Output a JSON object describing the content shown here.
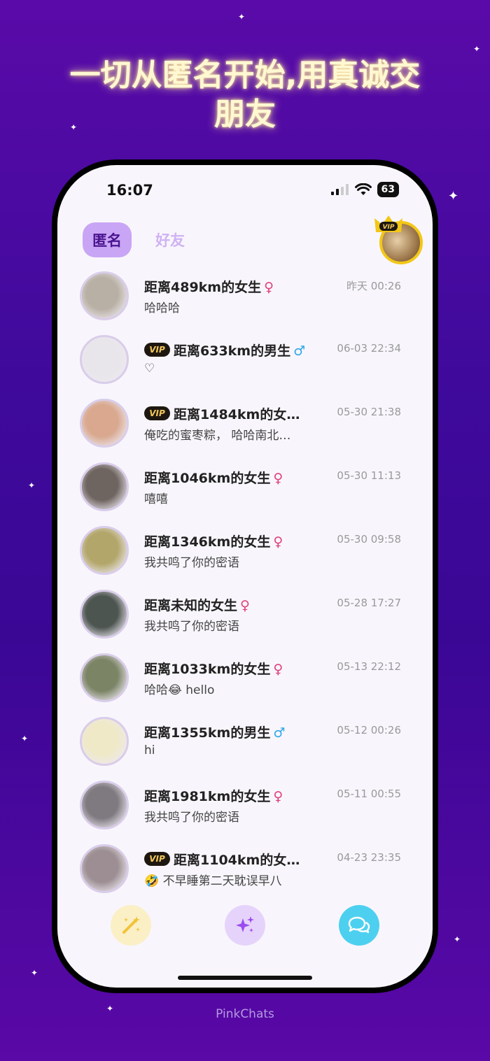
{
  "headline": {
    "line1": "一切从匿名开始,用真诚交",
    "line2": "朋友"
  },
  "status_bar": {
    "time": "16:07",
    "battery": "63"
  },
  "tabs": {
    "anonymous": "匿名",
    "friends": "好友"
  },
  "vip_label": "VIP",
  "chats": [
    {
      "name": "距离489km的女生",
      "gender": "♀",
      "vip": false,
      "message": "哈哈哈",
      "time": "昨天 00:26",
      "avatar_color": "#b8b0a4"
    },
    {
      "name": "距离633km的男生",
      "gender": "♂",
      "vip": true,
      "message": "♡",
      "time": "06-03 22:34",
      "avatar_color": "#e8e6ea"
    },
    {
      "name": "距离1484km的女…",
      "gender": "",
      "vip": true,
      "message": "俺吃的蜜枣粽， 哈哈南北…",
      "time": "05-30 21:38",
      "avatar_color": "#d9a88e"
    },
    {
      "name": "距离1046km的女生",
      "gender": "♀",
      "vip": false,
      "message": "嘻嘻",
      "time": "05-30 11:13",
      "avatar_color": "#6f6560"
    },
    {
      "name": "距离1346km的女生",
      "gender": "♀",
      "vip": false,
      "message": "我共鸣了你的密语",
      "time": "05-30 09:58",
      "avatar_color": "#b3a66a"
    },
    {
      "name": "距离未知的女生",
      "gender": "♀",
      "vip": false,
      "message": "我共鸣了你的密语",
      "time": "05-28 17:27",
      "avatar_color": "#4d5550"
    },
    {
      "name": "距离1033km的女生",
      "gender": "♀",
      "vip": false,
      "message": "哈哈😂 hello",
      "time": "05-13 22:12",
      "avatar_color": "#7c8466"
    },
    {
      "name": "距离1355km的男生",
      "gender": "♂",
      "vip": false,
      "message": "hi",
      "time": "05-12 00:26",
      "avatar_color": "#efe9c8"
    },
    {
      "name": "距离1981km的女生",
      "gender": "♀",
      "vip": false,
      "message": "我共鸣了你的密语",
      "time": "05-11 00:55",
      "avatar_color": "#7f7a80"
    },
    {
      "name": "距离1104km的女…",
      "gender": "",
      "vip": true,
      "message": "🤣 不早睡第二天耽误早八",
      "time": "04-23 23:35",
      "avatar_color": "#9c8e92"
    }
  ],
  "colors": {
    "female": "#e0407a",
    "male": "#2fa6e8",
    "accent": "#c9a5f5"
  },
  "bottom_nav": {
    "magic_icon": "magic-wand-icon",
    "sparkle_icon": "sparkles-icon",
    "chat_icon": "chat-bubbles-icon"
  },
  "footer": "PinkChats"
}
